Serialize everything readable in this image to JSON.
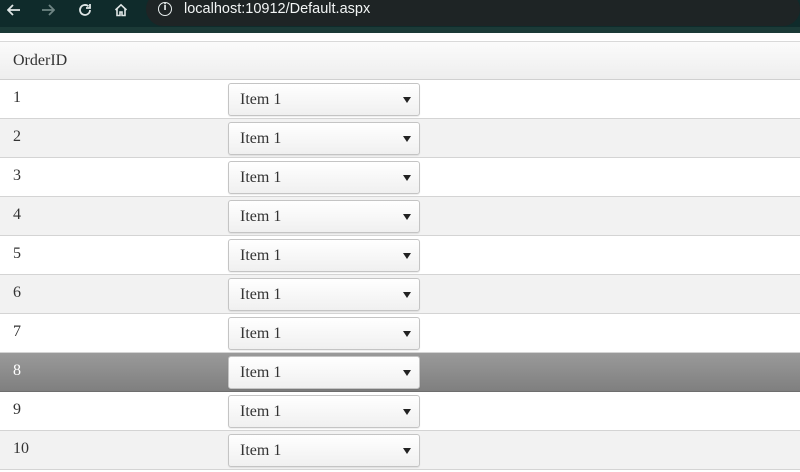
{
  "browser": {
    "url": "localhost:10912/Default.aspx",
    "icons": [
      "back-arrow-icon",
      "forward-arrow-icon",
      "reload-icon",
      "home-icon",
      "info-icon"
    ]
  },
  "grid": {
    "header": {
      "order_id": "OrderID"
    },
    "selected_order_id": "8",
    "rows": [
      {
        "order_id": "1",
        "item": "Item 1"
      },
      {
        "order_id": "2",
        "item": "Item 1"
      },
      {
        "order_id": "3",
        "item": "Item 1"
      },
      {
        "order_id": "4",
        "item": "Item 1"
      },
      {
        "order_id": "5",
        "item": "Item 1"
      },
      {
        "order_id": "6",
        "item": "Item 1"
      },
      {
        "order_id": "7",
        "item": "Item 1"
      },
      {
        "order_id": "8",
        "item": "Item 1"
      },
      {
        "order_id": "9",
        "item": "Item 1"
      },
      {
        "order_id": "10",
        "item": "Item 1"
      }
    ]
  },
  "colors": {
    "browser_bar": "#0f2b2b",
    "selected_row": "#8c8c8c",
    "alt_row": "#f2f2f2"
  }
}
